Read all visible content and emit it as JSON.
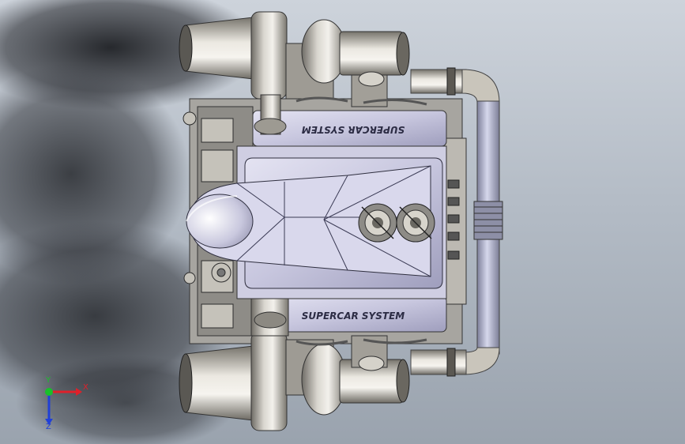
{
  "viewport": {
    "background_top": "#cdd3db",
    "background_bottom": "#9aa3ae"
  },
  "model": {
    "cover_text_top": "SUPERCAR SYSTEM",
    "cover_text_bottom": "SUPERCAR SYSTEM"
  },
  "triad": {
    "x_label": "X",
    "y_label": "Y",
    "z_label": "Z",
    "x_color": "#e0202a",
    "y_color": "#18c02a",
    "z_color": "#2040d8"
  }
}
